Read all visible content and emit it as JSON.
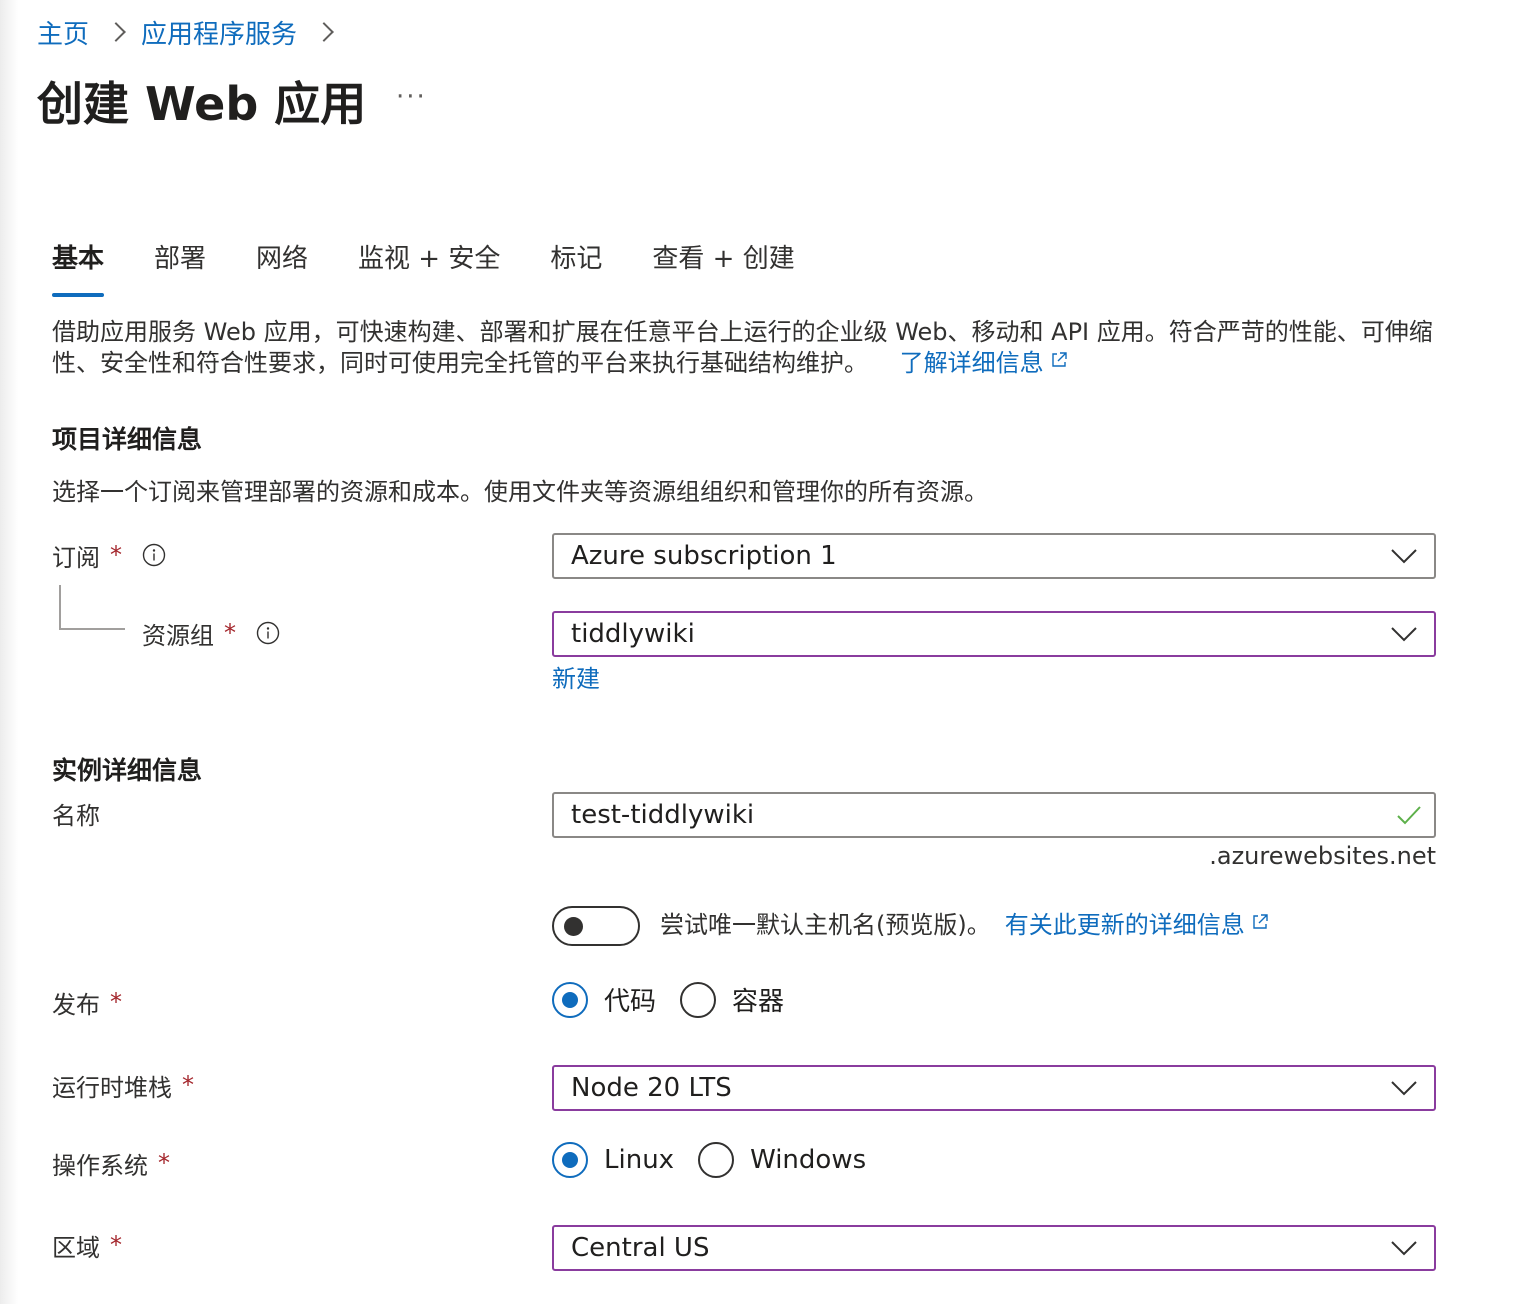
{
  "breadcrumb": {
    "home": "主页",
    "app_services": "应用程序服务"
  },
  "page": {
    "title": "创建 Web 应用",
    "more": "···"
  },
  "tabs": [
    {
      "label": "基本",
      "active": true
    },
    {
      "label": "部署"
    },
    {
      "label": "网络"
    },
    {
      "label": "监视 + 安全"
    },
    {
      "label": "标记"
    },
    {
      "label": "查看 + 创建"
    }
  ],
  "intro": {
    "text": "借助应用服务 Web 应用，可快速构建、部署和扩展在任意平台上运行的企业级 Web、移动和 API 应用。符合严苛的性能、可伸缩性、安全性和符合性要求，同时可使用完全托管的平台来执行基础结构维护。",
    "learn_more": "了解详细信息"
  },
  "project": {
    "title": "项目详细信息",
    "desc": "选择一个订阅来管理部署的资源和成本。使用文件夹等资源组组织和管理你的所有资源。",
    "subscription": {
      "label": "订阅",
      "required": "*",
      "value": "Azure subscription 1"
    },
    "resource_group": {
      "label": "资源组",
      "required": "*",
      "value": "tiddlywiki",
      "new_link": "新建"
    }
  },
  "instance": {
    "title": "实例详细信息",
    "name": {
      "label": "名称",
      "value": "test-tiddlywiki",
      "suffix": ".azurewebsites.net"
    },
    "unique_hostname": {
      "text": "尝试唯一默认主机名(预览版)。",
      "link": "有关此更新的详细信息",
      "enabled": false
    },
    "publish": {
      "label": "发布",
      "required": "*",
      "options": [
        "代码",
        "容器"
      ],
      "selected": "代码"
    },
    "runtime": {
      "label": "运行时堆栈",
      "required": "*",
      "value": "Node 20 LTS"
    },
    "os": {
      "label": "操作系统",
      "required": "*",
      "options": [
        "Linux",
        "Windows"
      ],
      "selected": "Linux"
    },
    "region": {
      "label": "区域",
      "required": "*",
      "value": "Central US"
    }
  },
  "colors": {
    "link": "#0f6cbd",
    "required": "#a4262c",
    "focus_border": "#8a3c9e",
    "valid_check": "#5db04a"
  }
}
